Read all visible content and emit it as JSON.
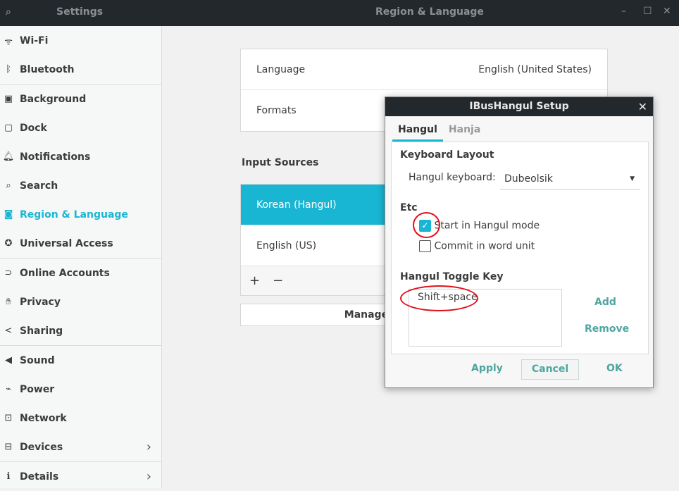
{
  "titlebar": {
    "left_title": "Settings",
    "main_title": "Region & Language",
    "search_icon": "search-icon",
    "controls": [
      "minimize",
      "maximize",
      "close"
    ]
  },
  "sidebar": {
    "items": [
      {
        "label": "Wi-Fi",
        "icon": "wifi-icon",
        "glyph": "ᯤ"
      },
      {
        "label": "Bluetooth",
        "icon": "bluetooth-icon",
        "glyph": "ᛒ"
      },
      {
        "label": "Background",
        "icon": "background-icon",
        "glyph": "▣"
      },
      {
        "label": "Dock",
        "icon": "dock-icon",
        "glyph": "▢"
      },
      {
        "label": "Notifications",
        "icon": "bell-icon",
        "glyph": "🔔︎"
      },
      {
        "label": "Search",
        "icon": "search-icon",
        "glyph": "⌕"
      },
      {
        "label": "Region & Language",
        "icon": "region-icon",
        "glyph": "◙",
        "active": true
      },
      {
        "label": "Universal Access",
        "icon": "accessibility-icon",
        "glyph": "✪"
      },
      {
        "label": "Online Accounts",
        "icon": "online-accounts-icon",
        "glyph": "⊃"
      },
      {
        "label": "Privacy",
        "icon": "hand-icon",
        "glyph": "✋︎"
      },
      {
        "label": "Sharing",
        "icon": "share-icon",
        "glyph": "<"
      },
      {
        "label": "Sound",
        "icon": "speaker-icon",
        "glyph": "◀"
      },
      {
        "label": "Power",
        "icon": "power-icon",
        "glyph": "⌁"
      },
      {
        "label": "Network",
        "icon": "network-icon",
        "glyph": "⊡"
      },
      {
        "label": "Devices",
        "icon": "devices-icon",
        "glyph": "⊟",
        "chevron": true
      },
      {
        "label": "Details",
        "icon": "info-icon",
        "glyph": "ℹ",
        "chevron": true
      }
    ]
  },
  "main": {
    "language_label": "Language",
    "language_value": "English (United States)",
    "formats_label": "Formats",
    "input_sources_heading": "Input Sources",
    "input_sources": [
      "Korean (Hangul)",
      "English (US)"
    ],
    "add": "+",
    "remove": "−",
    "manage_button": "Manage Installed Languages"
  },
  "dialog": {
    "title": "IBusHangul Setup",
    "close": "✕",
    "tabs": [
      "Hangul",
      "Hanja"
    ],
    "keyboard_layout_heading": "Keyboard Layout",
    "hangul_keyboard_label": "Hangul keyboard:",
    "hangul_keyboard_value": "Dubeolsik",
    "etc_heading": "Etc",
    "start_hangul": {
      "label": "Start in Hangul mode",
      "checked": true
    },
    "commit_word": {
      "label": "Commit in word unit",
      "checked": false
    },
    "toggle_heading": "Hangul Toggle Key",
    "toggle_keys": [
      "Shift+space"
    ],
    "add": "Add",
    "remove": "Remove",
    "apply": "Apply",
    "cancel": "Cancel",
    "ok": "OK"
  },
  "colors": {
    "accent": "#19b6d3",
    "titlebar": "#23282d",
    "annotation": "#e3101a",
    "link": "#4ea6a0"
  }
}
